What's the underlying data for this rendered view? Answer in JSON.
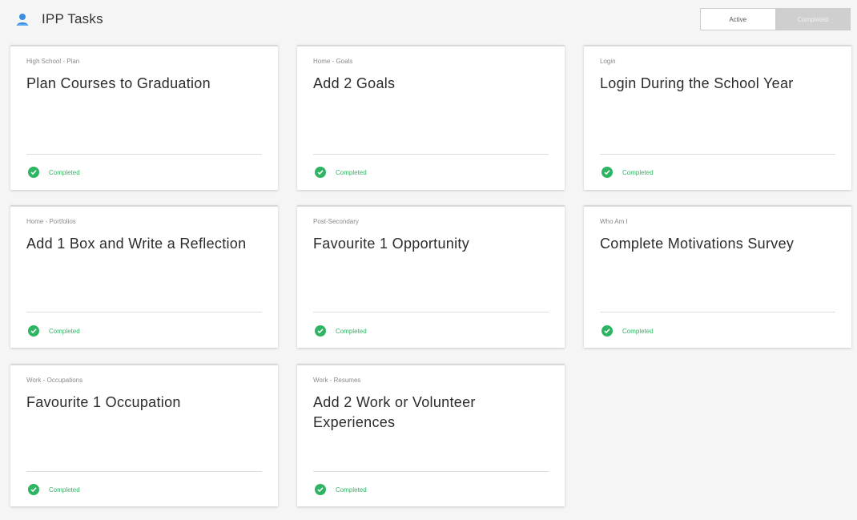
{
  "header": {
    "title": "IPP Tasks",
    "icon": "user-group-icon",
    "icon_color": "#3a8de0"
  },
  "toggle": {
    "active_label": "Active",
    "completed_label": "Completed",
    "selected": "Completed"
  },
  "status_color": "#2fb463",
  "tasks": [
    {
      "category": "High School - Plan",
      "title": "Plan Courses to Graduation",
      "status": "Completed"
    },
    {
      "category": "Home - Goals",
      "title": "Add 2 Goals",
      "status": "Completed"
    },
    {
      "category": "Login",
      "title": "Login During the School Year",
      "status": "Completed"
    },
    {
      "category": "Home - Portfolios",
      "title": "Add 1 Box and Write a Reflection",
      "status": "Completed"
    },
    {
      "category": "Post-Secondary",
      "title": "Favourite 1 Opportunity",
      "status": "Completed"
    },
    {
      "category": "Who Am I",
      "title": "Complete Motivations Survey",
      "status": "Completed"
    },
    {
      "category": "Work - Occupations",
      "title": "Favourite 1 Occupation",
      "status": "Completed"
    },
    {
      "category": "Work - Resumes",
      "title": "Add 2 Work or Volunteer Experiences",
      "status": "Completed"
    }
  ]
}
